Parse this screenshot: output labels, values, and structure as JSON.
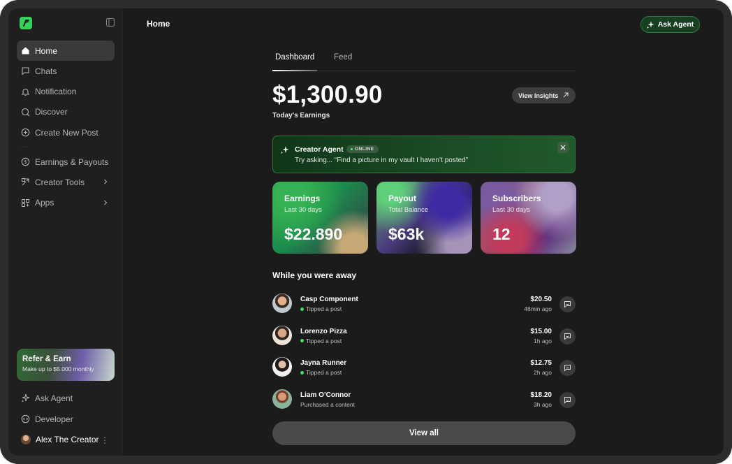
{
  "sidebar": {
    "nav": [
      {
        "label": "Home",
        "icon": "home-icon",
        "active": true
      },
      {
        "label": "Chats",
        "icon": "chat-icon"
      },
      {
        "label": "Notification",
        "icon": "bell-icon"
      },
      {
        "label": "Discover",
        "icon": "search-icon"
      },
      {
        "label": "Create New Post",
        "icon": "plus-square-icon"
      }
    ],
    "nav2": [
      {
        "label": "Earnings & Payouts",
        "icon": "dollar-circle-icon"
      },
      {
        "label": "Creator Tools",
        "icon": "tools-icon"
      },
      {
        "label": "Apps",
        "icon": "apps-grid-icon"
      }
    ],
    "refer": {
      "title": "Refer & Earn",
      "subtitle": "Make up to $5.000 monthly"
    },
    "bottom": [
      {
        "label": "Ask Agent",
        "icon": "sparkle-icon"
      },
      {
        "label": "Developer",
        "icon": "code-icon"
      }
    ],
    "user": {
      "name": "Alex The Creator"
    }
  },
  "header": {
    "title": "Home",
    "ask_agent": "Ask Agent"
  },
  "tabs": [
    "Dashboard",
    "Feed"
  ],
  "earnings": {
    "amount": "$1,300.90",
    "label": "Today's Earnings",
    "insights_button": "View Insights"
  },
  "agent_card": {
    "name": "Creator Agent",
    "status": "ONLINE",
    "prompt": "Try asking...  “Find a picture in my vault I haven’t posted”"
  },
  "stats": [
    {
      "title": "Earnings",
      "subtitle": "Last 30 days",
      "value": "$22.890"
    },
    {
      "title": "Payout",
      "subtitle": "Total Balance",
      "value": "$63k"
    },
    {
      "title": "Subscribers",
      "subtitle": "Last 30 days",
      "value": "12"
    }
  ],
  "away": {
    "title": "While you were away",
    "items": [
      {
        "name": "Casp Component",
        "action": "Tipped a post",
        "amount": "$20.50",
        "time": "48min ago",
        "dot": true
      },
      {
        "name": "Lorenzo Pizza",
        "action": "Tipped a post",
        "amount": "$15.00",
        "time": "1h ago",
        "dot": true
      },
      {
        "name": "Jayna Runner",
        "action": "Tipped a post",
        "amount": "$12.75",
        "time": "2h ago",
        "dot": true
      },
      {
        "name": "Liam O’Connor",
        "action": "Purchased a content",
        "amount": "$18.20",
        "time": "3h ago",
        "dot": false
      }
    ],
    "view_all": "View all"
  },
  "colors": {
    "accent": "#36d15a",
    "online": "#3ee25d",
    "background": "#1b1b1b"
  }
}
